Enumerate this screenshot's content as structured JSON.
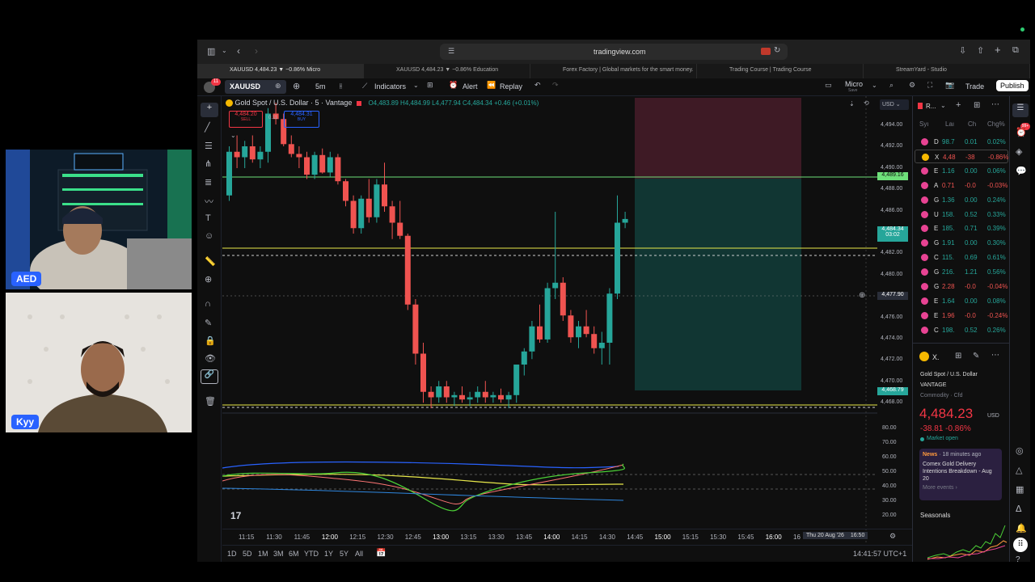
{
  "colors": {
    "up": "#26a69a",
    "down": "#ef5350",
    "accent": "#2962ff",
    "bg": "#0f0f0f"
  },
  "cams": {
    "top_label": "AED",
    "bottom_label": "Kyy"
  },
  "browser": {
    "url": "tradingview.com",
    "tabs": [
      "XAUUSD 4,484.23 ▼ −0.86% Micro",
      "XAUUSD 4,484.23 ▼ −0.86% Education",
      "Forex Factory | Global markets for the smart money.",
      "Trading Course | Trading Course",
      "StreamYard - Studio"
    ]
  },
  "toolbar": {
    "avatar_badge": "11",
    "symbol": "XAUUSD",
    "interval": "5m",
    "indicators": "Indicators",
    "alert": "Alert",
    "replay": "Replay",
    "layout_name": "Micro",
    "layout_sub": "Save",
    "trade": "Trade",
    "publish": "Publish"
  },
  "legend": {
    "title": "Gold Spot / U.S. Dollar · 5 · Vantage",
    "ohlc": "O4,483.89 H4,484.99 L4,477.94 C4,484.34 +0.46 (+0.01%)",
    "sell_price": "4,484.20",
    "sell_label": "SELL",
    "spread": "0.11",
    "buy_price": "4,484.31",
    "buy_label": "BUY",
    "currency": "USD"
  },
  "price_axis": {
    "ticks": [
      "4,494.00",
      "4,492.00",
      "4,490.00",
      "4,488.00",
      "4,486.00",
      "4,484.00",
      "4,482.00",
      "4,480.00",
      "4,478.00",
      "4,476.00",
      "4,474.00",
      "4,472.00",
      "4,470.00",
      "4,468.00"
    ],
    "hline_label": "4,489.16",
    "last_price": "4,484.34",
    "countdown": "03:02",
    "cursor_price": "4,477.90",
    "low_label": "4,468.79",
    "osc_ticks": [
      "80.00",
      "70.00",
      "60.00",
      "50.00",
      "40.00",
      "30.00",
      "20.00"
    ]
  },
  "time_axis": {
    "ticks": [
      "11:15",
      "11:30",
      "11:45",
      "12:00",
      "12:15",
      "12:30",
      "12:45",
      "13:00",
      "13:15",
      "13:30",
      "13:45",
      "14:00",
      "14:15",
      "14:30",
      "14:45",
      "15:00",
      "15:15",
      "15:30",
      "15:45",
      "16:00",
      "16"
    ],
    "cursor_label": "Thu 20 Aug '26",
    "cursor_time": "16:50"
  },
  "bottom": {
    "ranges": [
      "1D",
      "5D",
      "1M",
      "3M",
      "6M",
      "YTD",
      "1Y",
      "5Y",
      "All"
    ],
    "clock": "14:41:57 UTC+1"
  },
  "watchlist": {
    "header": "R...",
    "columns": [
      "Syı",
      "Laı",
      "Ch",
      "Chg%"
    ],
    "rows": [
      {
        "s": "D",
        "last": "98.7",
        "ch": "0.01",
        "pct": "0.02%",
        "up": true
      },
      {
        "s": "X",
        "last": "4,48",
        "ch": "-38",
        "pct": "-0.86%",
        "up": false
      },
      {
        "s": "E",
        "last": "1.16",
        "ch": "0.00",
        "pct": "0.06%",
        "up": true
      },
      {
        "s": "A",
        "last": "0.71",
        "ch": "-0.0",
        "pct": "-0.03%",
        "up": false
      },
      {
        "s": "G",
        "last": "1.36",
        "ch": "0.00",
        "pct": "0.24%",
        "up": true
      },
      {
        "s": "U",
        "last": "158.",
        "ch": "0.52",
        "pct": "0.33%",
        "up": true
      },
      {
        "s": "E",
        "last": "185.",
        "ch": "0.71",
        "pct": "0.39%",
        "up": true
      },
      {
        "s": "G",
        "last": "1.91",
        "ch": "0.00",
        "pct": "0.30%",
        "up": true
      },
      {
        "s": "C",
        "last": "115.",
        "ch": "0.69",
        "pct": "0.61%",
        "up": true
      },
      {
        "s": "G",
        "last": "216.",
        "ch": "1.21",
        "pct": "0.56%",
        "up": true
      },
      {
        "s": "G",
        "last": "2.28",
        "ch": "-0.0",
        "pct": "-0.04%",
        "up": false
      },
      {
        "s": "E",
        "last": "1.64",
        "ch": "0.00",
        "pct": "0.08%",
        "up": true
      },
      {
        "s": "E",
        "last": "1.96",
        "ch": "-0.0",
        "pct": "-0.24%",
        "up": false
      },
      {
        "s": "C",
        "last": "198.",
        "ch": "0.52",
        "pct": "0.26%",
        "up": true
      }
    ]
  },
  "details": {
    "symbol_short": "X.",
    "name": "Gold Spot / U.S. Dollar",
    "exchange": "VANTAGE",
    "category": "Commodity · Cfd",
    "price": "4,484.23",
    "currency": "USD",
    "change": "-38.81 -0.86%",
    "status": "Market open",
    "news_tag": "News",
    "news_time": "· 18 minutes ago",
    "news_headline": "Comex Gold Delivery Intentions Breakdown - Aug 20",
    "news_more": "More events ›",
    "seasonals": "Seasonals"
  },
  "right_badge": "99+",
  "chart_data": {
    "type": "candlestick",
    "ylim": [
      4467,
      4495
    ],
    "candles": [
      [
        4486.5,
        4491.0,
        4486.0,
        4490.5
      ],
      [
        4490.5,
        4492.0,
        4489.0,
        4490.0
      ],
      [
        4490.0,
        4491.5,
        4489.0,
        4491.0
      ],
      [
        4491.0,
        4492.0,
        4489.5,
        4489.8
      ],
      [
        4489.8,
        4491.0,
        4489.0,
        4490.5
      ],
      [
        4490.5,
        4494.5,
        4489.5,
        4494.0
      ],
      [
        4494.0,
        4495.0,
        4493.0,
        4493.5
      ],
      [
        4493.5,
        4494.0,
        4491.0,
        4491.2
      ],
      [
        4491.2,
        4492.0,
        4490.0,
        4490.3
      ],
      [
        4490.3,
        4491.0,
        4489.0,
        4490.0
      ],
      [
        4490.0,
        4490.5,
        4488.0,
        4488.4
      ],
      [
        4488.4,
        4490.5,
        4488.0,
        4490.2
      ],
      [
        4490.2,
        4490.8,
        4488.5,
        4488.6
      ],
      [
        4488.6,
        4490.5,
        4488.2,
        4490.0
      ],
      [
        4490.0,
        4490.3,
        4487.5,
        4487.8
      ],
      [
        4487.8,
        4488.0,
        4485.5,
        4486.0
      ],
      [
        4486.0,
        4486.5,
        4483.0,
        4483.5
      ],
      [
        4483.5,
        4486.5,
        4483.0,
        4486.2
      ],
      [
        4486.2,
        4488.0,
        4484.0,
        4484.5
      ],
      [
        4484.5,
        4488.0,
        4484.0,
        4487.5
      ],
      [
        4487.5,
        4489.5,
        4485.0,
        4485.5
      ],
      [
        4485.5,
        4486.0,
        4482.5,
        4484.0
      ],
      [
        4484.0,
        4486.0,
        4482.5,
        4482.8
      ],
      [
        4482.8,
        4483.0,
        4476.0,
        4476.5
      ],
      [
        4476.5,
        4477.0,
        4471.0,
        4472.0
      ],
      [
        4472.0,
        4473.0,
        4467.5,
        4468.5
      ],
      [
        4468.5,
        4469.0,
        4467.0,
        4468.0
      ],
      [
        4468.0,
        4469.5,
        4467.5,
        4469.0
      ],
      [
        4469.0,
        4469.5,
        4467.5,
        4468.0
      ],
      [
        4468.0,
        4468.5,
        4467.2,
        4468.2
      ],
      [
        4468.2,
        4469.0,
        4467.5,
        4467.8
      ],
      [
        4467.8,
        4468.5,
        4467.2,
        4468.0
      ],
      [
        4468.0,
        4469.0,
        4467.5,
        4468.5
      ],
      [
        4468.5,
        4469.5,
        4467.5,
        4468.0
      ],
      [
        4468.0,
        4468.5,
        4467.5,
        4468.2
      ],
      [
        4468.2,
        4468.8,
        4467.5,
        4467.8
      ],
      [
        4467.8,
        4468.5,
        4467.0,
        4468.2
      ],
      [
        4468.2,
        4470.0,
        4467.5,
        4471.0
      ],
      [
        4471.0,
        4472.5,
        4470.0,
        4472.2
      ],
      [
        4472.2,
        4475.0,
        4471.5,
        4474.5
      ],
      [
        4474.5,
        4476.5,
        4473.0,
        4473.3
      ],
      [
        4473.3,
        4478.5,
        4473.0,
        4478.0
      ],
      [
        4478.0,
        4485.0,
        4477.0,
        4478.5
      ],
      [
        4478.5,
        4479.0,
        4475.0,
        4475.5
      ],
      [
        4475.5,
        4476.0,
        4473.0,
        4473.5
      ],
      [
        4473.5,
        4475.0,
        4472.5,
        4474.5
      ],
      [
        4474.5,
        4476.0,
        4473.5,
        4473.8
      ],
      [
        4473.8,
        4474.5,
        4472.0,
        4472.5
      ],
      [
        4472.5,
        4474.0,
        4471.0,
        4473.0
      ],
      [
        4473.0,
        4478.0,
        4471.0,
        4477.5
      ],
      [
        4477.5,
        4486.5,
        4477.0,
        4484.0
      ],
      [
        4484.0,
        4485.0,
        4483.5,
        4484.34
      ]
    ]
  }
}
